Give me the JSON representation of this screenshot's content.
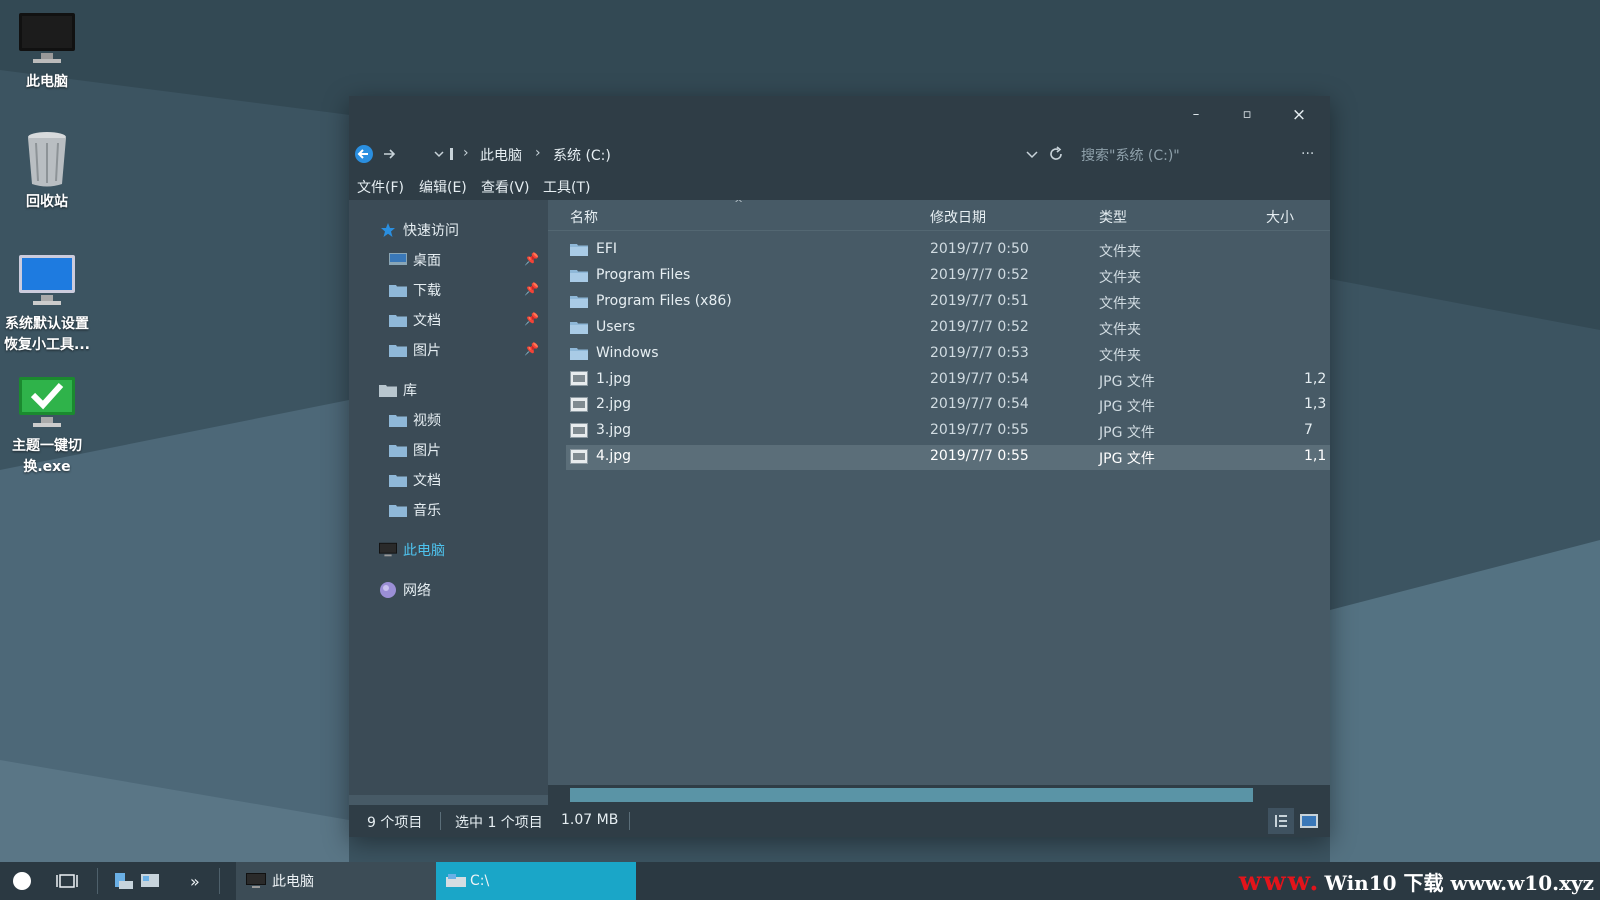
{
  "desktop": {
    "icons": [
      {
        "label": "此电脑",
        "icon": "monitor-icon"
      },
      {
        "label": "回收站",
        "icon": "recycle-bin-icon"
      },
      {
        "label": "系统默认设置恢复小工具...",
        "icon": "monitor-blue-icon"
      },
      {
        "label": "主题一键切换.exe",
        "icon": "checkmark-monitor-icon"
      }
    ]
  },
  "window": {
    "controls": {
      "minimize": "–",
      "maximize": "▫",
      "close": "×"
    },
    "address": {
      "crumbs": [
        "此电脑",
        "系统 (C:)"
      ],
      "search_placeholder": "搜索\"系统 (C:)\"",
      "more": "..."
    },
    "menu": [
      "文件(F)",
      "编辑(E)",
      "查看(V)",
      "工具(T)"
    ],
    "nav": {
      "quick_access": "快速访问",
      "quick_items": [
        "桌面",
        "下载",
        "文档",
        "图片"
      ],
      "library": "库",
      "library_items": [
        "视频",
        "图片",
        "文档",
        "音乐"
      ],
      "this_pc": "此电脑",
      "network": "网络"
    },
    "columns": {
      "name": "名称",
      "date": "修改日期",
      "type": "类型",
      "size": "大小"
    },
    "files": [
      {
        "name": "EFI",
        "date": "2019/7/7 0:50",
        "type": "文件夹",
        "size": "",
        "kind": "folder"
      },
      {
        "name": "Program Files",
        "date": "2019/7/7 0:52",
        "type": "文件夹",
        "size": "",
        "kind": "folder"
      },
      {
        "name": "Program Files (x86)",
        "date": "2019/7/7 0:51",
        "type": "文件夹",
        "size": "",
        "kind": "folder"
      },
      {
        "name": "Users",
        "date": "2019/7/7 0:52",
        "type": "文件夹",
        "size": "",
        "kind": "folder"
      },
      {
        "name": "Windows",
        "date": "2019/7/7 0:53",
        "type": "文件夹",
        "size": "",
        "kind": "folder"
      },
      {
        "name": "1.jpg",
        "date": "2019/7/7 0:54",
        "type": "JPG 文件",
        "size": "1,2",
        "kind": "image"
      },
      {
        "name": "2.jpg",
        "date": "2019/7/7 0:54",
        "type": "JPG 文件",
        "size": "1,3",
        "kind": "image"
      },
      {
        "name": "3.jpg",
        "date": "2019/7/7 0:55",
        "type": "JPG 文件",
        "size": "7",
        "kind": "image"
      },
      {
        "name": "4.jpg",
        "date": "2019/7/7 0:55",
        "type": "JPG 文件",
        "size": "1,1",
        "kind": "image",
        "selected": true
      }
    ],
    "status": {
      "count": "9 个项目",
      "selected": "选中 1 个项目",
      "size": "1.07 MB"
    }
  },
  "taskbar": {
    "overflow": "»",
    "apps": [
      {
        "label": "此电脑",
        "active": false
      },
      {
        "label": "C:\\",
        "active": true
      }
    ],
    "watermark_red": "www.",
    "watermark_text": "Win10 下载 www.w10.xyz"
  },
  "colors": {
    "accent": "#4ec3ee",
    "window": "#475a66",
    "chrome": "#2f3d46",
    "active_task": "#1aa6c8"
  }
}
